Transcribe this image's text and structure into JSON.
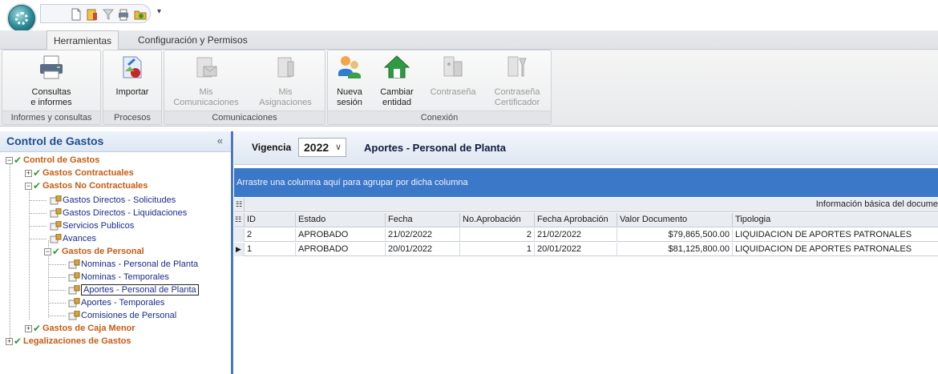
{
  "tabs": [
    {
      "label": "Herramientas",
      "active": true
    },
    {
      "label": "Configuración y Permisos",
      "active": false
    }
  ],
  "ribbon": {
    "groups": [
      {
        "label": "Informes y consultas",
        "buttons": [
          {
            "label": "Consultas\ne informes",
            "icon": "printer-icon",
            "enabled": true
          }
        ]
      },
      {
        "label": "Procesos",
        "buttons": [
          {
            "label": "Importar",
            "icon": "import-icon",
            "enabled": true
          }
        ]
      },
      {
        "label": "Comunicaciones",
        "buttons": [
          {
            "label": "Mis\nComunicaciones",
            "icon": "communications-icon",
            "enabled": false
          },
          {
            "label": "Mis\nAsignaciones",
            "icon": "assignments-icon",
            "enabled": false
          }
        ]
      },
      {
        "label": "Conexión",
        "buttons": [
          {
            "label": "Nueva\nsesión",
            "icon": "users-icon",
            "enabled": true
          },
          {
            "label": "Cambiar\nentidad",
            "icon": "home-icon",
            "enabled": true
          },
          {
            "label": "Contraseña",
            "icon": "password-icon",
            "enabled": false
          },
          {
            "label": "Contraseña\nCertificador",
            "icon": "certificate-password-icon",
            "enabled": false
          }
        ]
      }
    ]
  },
  "nav": {
    "title": "Control de Gastos",
    "collapse_glyph": "«",
    "tree": [
      {
        "label": "Control de Gastos",
        "type": "group",
        "expander": "−"
      },
      {
        "label": "Gastos Contractuales",
        "type": "group",
        "expander": "+"
      },
      {
        "label": "Gastos No Contractuales",
        "type": "group",
        "expander": "−"
      },
      {
        "label": "Gastos Directos - Solicitudes",
        "type": "leaf"
      },
      {
        "label": "Gastos Directos - Liquidaciones",
        "type": "leaf"
      },
      {
        "label": "Servicios Publicos",
        "type": "leaf"
      },
      {
        "label": "Avances",
        "type": "leaf"
      },
      {
        "label": "Gastos de Personal",
        "type": "group",
        "expander": "−"
      },
      {
        "label": "Nominas - Personal de Planta",
        "type": "leaf"
      },
      {
        "label": "Nominas - Temporales",
        "type": "leaf"
      },
      {
        "label": "Aportes - Personal de Planta",
        "type": "leaf",
        "selected": true
      },
      {
        "label": "Aportes - Temporales",
        "type": "leaf"
      },
      {
        "label": "Comisiones de Personal",
        "type": "leaf"
      },
      {
        "label": "Gastos de Caja Menor",
        "type": "group",
        "expander": "+"
      },
      {
        "label": "Legalizaciones de Gastos",
        "type": "group",
        "expander": "+"
      }
    ]
  },
  "main": {
    "vigencia_label": "Vigencia",
    "vigencia_value": "2022",
    "view_title": "Aportes - Personal de Planta",
    "group_panel_text": "Arrastre una columna aquí para agrupar por dicha columna",
    "band_label": "Información básica del docume",
    "columns": [
      "ID",
      "Estado",
      "Fecha",
      "No.Aprobación",
      "Fecha Aprobación",
      "Valor Documento",
      "Tipologia"
    ],
    "rows": [
      {
        "id": "2",
        "estado": "APROBADO",
        "fecha": "21/02/2022",
        "no_aprobacion": "2",
        "fecha_aprobacion": "21/02/2022",
        "valor": "$79,865,500.00",
        "tipologia": "LIQUIDACION DE APORTES PATRONALES",
        "current": false
      },
      {
        "id": "1",
        "estado": "APROBADO",
        "fecha": "20/01/2022",
        "no_aprobacion": "1",
        "fecha_aprobacion": "20/01/2022",
        "valor": "$81,125,800.00",
        "tipologia": "LIQUIDACION DE APORTES PATRONALES",
        "current": true
      }
    ]
  },
  "colors": {
    "accent_blue": "#3c78c8",
    "group_node": "#c75b12",
    "leaf_node": "#1a2d8a",
    "check_green": "#2e9a2e"
  }
}
